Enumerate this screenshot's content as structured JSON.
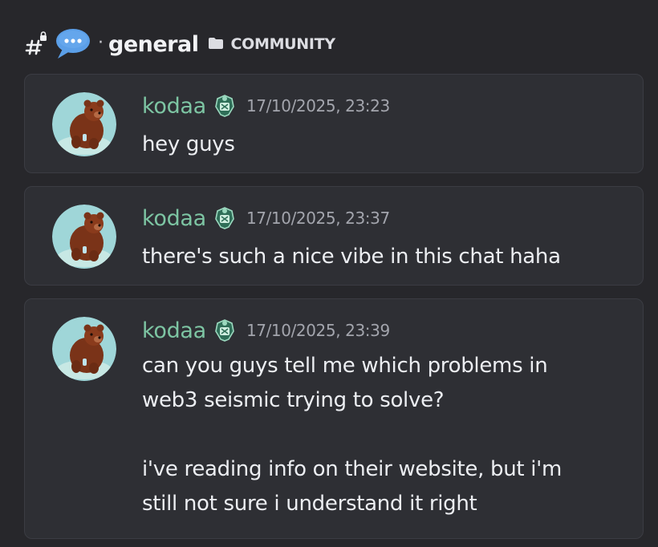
{
  "channel": {
    "name": "general",
    "separator": "·",
    "category": "COMMUNITY"
  },
  "colors": {
    "background": "#27272b",
    "message_bg": "#2e2f34",
    "author": "#7dc5a3",
    "timestamp": "#a3a5ad",
    "bubble": "#5b9fe8"
  },
  "icons": {
    "channel": "hash-lock-icon",
    "chat": "speech-bubble-icon",
    "folder": "folder-icon",
    "badge": "shield-badge-icon",
    "avatar": "bear-avatar"
  },
  "messages": [
    {
      "author": "kodaa",
      "timestamp": "17/10/2025, 23:23",
      "text": "hey guys"
    },
    {
      "author": "kodaa",
      "timestamp": "17/10/2025, 23:37",
      "text": "there's such a nice vibe in this chat haha"
    },
    {
      "author": "kodaa",
      "timestamp": "17/10/2025, 23:39",
      "text": "can you guys tell me which problems in\nweb3 seismic trying to solve?\n\ni've reading info on their website, but i'm\nstill not sure i understand it right"
    }
  ]
}
